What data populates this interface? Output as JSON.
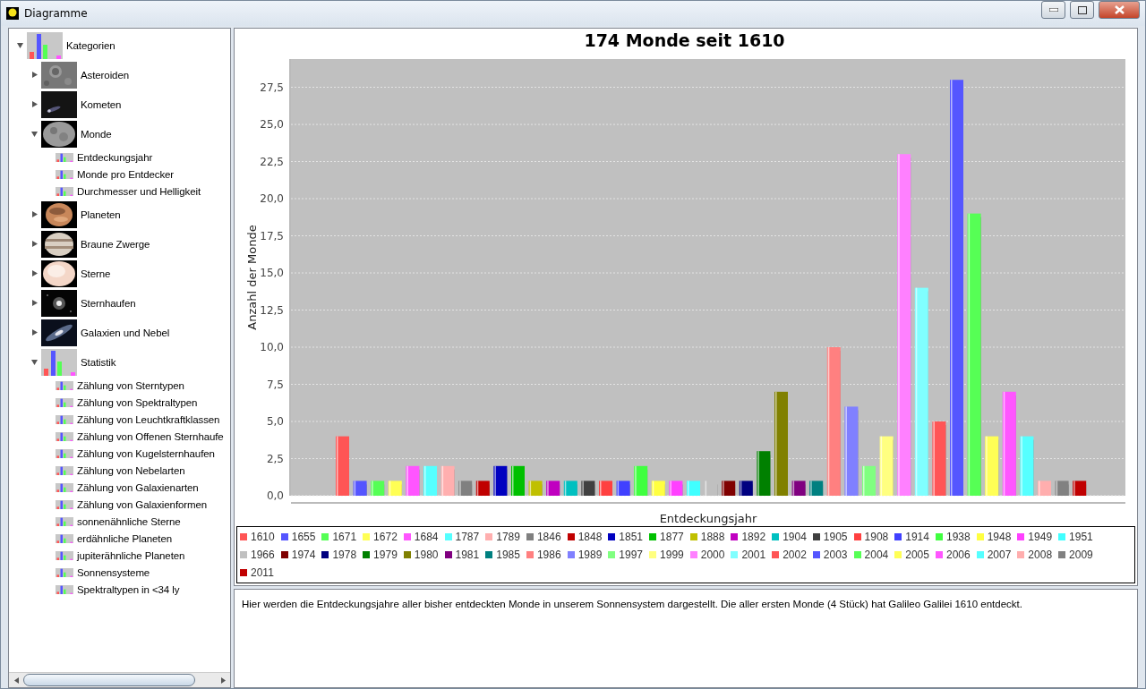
{
  "window": {
    "title": "Diagramme"
  },
  "tree": {
    "label": "Kategorien",
    "kind": "chart",
    "expanded": true,
    "children": [
      {
        "label": "Asteroiden",
        "expanded": false
      },
      {
        "label": "Kometen",
        "expanded": false
      },
      {
        "label": "Monde",
        "expanded": true,
        "children": [
          {
            "label": "Entdeckungsjahr",
            "kind": "item"
          },
          {
            "label": "Monde pro Entdecker",
            "kind": "item"
          },
          {
            "label": "Durchmesser und Helligkeit",
            "kind": "item"
          }
        ]
      },
      {
        "label": "Planeten",
        "expanded": false
      },
      {
        "label": "Braune Zwerge",
        "expanded": false
      },
      {
        "label": "Sterne",
        "expanded": false
      },
      {
        "label": "Sternhaufen",
        "expanded": false
      },
      {
        "label": "Galaxien und Nebel",
        "expanded": false
      },
      {
        "label": "Statistik",
        "kind": "chart",
        "expanded": true,
        "children": [
          {
            "label": "Zählung von Sterntypen",
            "kind": "item"
          },
          {
            "label": "Zählung von Spektraltypen",
            "kind": "item"
          },
          {
            "label": "Zählung von Leuchtkraftklassen",
            "kind": "item"
          },
          {
            "label": "Zählung von Offenen Sternhaufe",
            "kind": "item"
          },
          {
            "label": "Zählung von Kugelsternhaufen",
            "kind": "item"
          },
          {
            "label": "Zählung von Nebelarten",
            "kind": "item"
          },
          {
            "label": "Zählung von Galaxienarten",
            "kind": "item"
          },
          {
            "label": "Zählung von Galaxienformen",
            "kind": "item"
          },
          {
            "label": "sonnenähnliche Sterne",
            "kind": "item"
          },
          {
            "label": "erdähnliche Planeten",
            "kind": "item"
          },
          {
            "label": "jupiterähnliche Planeten",
            "kind": "item"
          },
          {
            "label": "Sonnensysteme",
            "kind": "item"
          },
          {
            "label": "Spektraltypen in <34 ly",
            "kind": "item"
          }
        ]
      }
    ]
  },
  "chart": {
    "chart_data": {
      "type": "bar",
      "title": "174 Monde seit 1610",
      "xlabel": "Entdeckungsjahr",
      "ylabel": "Anzahl der Monde",
      "ylim": [
        0,
        29.4
      ],
      "grid": true,
      "yticks": [
        {
          "value": 0,
          "label": "0,0"
        },
        {
          "value": 2.5,
          "label": "2,5"
        },
        {
          "value": 5,
          "label": "5,0"
        },
        {
          "value": 7.5,
          "label": "7,5"
        },
        {
          "value": 10,
          "label": "10,0"
        },
        {
          "value": 12.5,
          "label": "12,5"
        },
        {
          "value": 15,
          "label": "15,0"
        },
        {
          "value": 17.5,
          "label": "17,5"
        },
        {
          "value": 20,
          "label": "20,0"
        },
        {
          "value": 22.5,
          "label": "22,5"
        },
        {
          "value": 25,
          "label": "25,0"
        },
        {
          "value": 27.5,
          "label": "27,5"
        }
      ],
      "series": [
        {
          "name": "1610",
          "color": "#ff5555",
          "values": [
            4
          ]
        },
        {
          "name": "1655",
          "color": "#5555ff",
          "values": [
            1
          ]
        },
        {
          "name": "1671",
          "color": "#55ff55",
          "values": [
            1
          ]
        },
        {
          "name": "1672",
          "color": "#ffff55",
          "values": [
            1
          ]
        },
        {
          "name": "1684",
          "color": "#ff55ff",
          "values": [
            2
          ]
        },
        {
          "name": "1787",
          "color": "#55ffff",
          "values": [
            2
          ]
        },
        {
          "name": "1789",
          "color": "#ffafaf",
          "values": [
            2
          ]
        },
        {
          "name": "1846",
          "color": "#808080",
          "values": [
            1
          ]
        },
        {
          "name": "1848",
          "color": "#c00000",
          "values": [
            1
          ]
        },
        {
          "name": "1851",
          "color": "#0000c0",
          "values": [
            2
          ]
        },
        {
          "name": "1877",
          "color": "#00c000",
          "values": [
            2
          ]
        },
        {
          "name": "1888",
          "color": "#c0c000",
          "values": [
            1
          ]
        },
        {
          "name": "1892",
          "color": "#c000c0",
          "values": [
            1
          ]
        },
        {
          "name": "1904",
          "color": "#00c0c0",
          "values": [
            1
          ]
        },
        {
          "name": "1905",
          "color": "#404040",
          "values": [
            1
          ]
        },
        {
          "name": "1908",
          "color": "#ff4040",
          "values": [
            1
          ]
        },
        {
          "name": "1914",
          "color": "#4040ff",
          "values": [
            1
          ]
        },
        {
          "name": "1938",
          "color": "#40ff40",
          "values": [
            2
          ]
        },
        {
          "name": "1948",
          "color": "#ffff40",
          "values": [
            1
          ]
        },
        {
          "name": "1949",
          "color": "#ff40ff",
          "values": [
            1
          ]
        },
        {
          "name": "1951",
          "color": "#40ffff",
          "values": [
            1
          ]
        },
        {
          "name": "1966",
          "color": "#c0c0c0",
          "values": [
            1
          ]
        },
        {
          "name": "1974",
          "color": "#800000",
          "values": [
            1
          ]
        },
        {
          "name": "1978",
          "color": "#000080",
          "values": [
            1
          ]
        },
        {
          "name": "1979",
          "color": "#008000",
          "values": [
            3
          ]
        },
        {
          "name": "1980",
          "color": "#808000",
          "values": [
            7
          ]
        },
        {
          "name": "1981",
          "color": "#800080",
          "values": [
            1
          ]
        },
        {
          "name": "1985",
          "color": "#008080",
          "values": [
            1
          ]
        },
        {
          "name": "1986",
          "color": "#ff8080",
          "values": [
            10
          ]
        },
        {
          "name": "1989",
          "color": "#8080ff",
          "values": [
            6
          ]
        },
        {
          "name": "1997",
          "color": "#80ff80",
          "values": [
            2
          ]
        },
        {
          "name": "1999",
          "color": "#ffff80",
          "values": [
            4
          ]
        },
        {
          "name": "2000",
          "color": "#ff80ff",
          "values": [
            23
          ]
        },
        {
          "name": "2001",
          "color": "#80ffff",
          "values": [
            14
          ]
        },
        {
          "name": "2002",
          "color": "#ff5556",
          "values": [
            5
          ]
        },
        {
          "name": "2003",
          "color": "#5556ff",
          "values": [
            28
          ]
        },
        {
          "name": "2004",
          "color": "#56ff55",
          "values": [
            19
          ]
        },
        {
          "name": "2005",
          "color": "#ffff56",
          "values": [
            4
          ]
        },
        {
          "name": "2006",
          "color": "#ff56ff",
          "values": [
            7
          ]
        },
        {
          "name": "2007",
          "color": "#56ffff",
          "values": [
            4
          ]
        },
        {
          "name": "2008",
          "color": "#ffaeae",
          "values": [
            1
          ]
        },
        {
          "name": "2009",
          "color": "#818181",
          "values": [
            1
          ]
        },
        {
          "name": "2011",
          "color": "#c00001",
          "values": [
            1
          ]
        }
      ]
    }
  },
  "description": "Hier werden die Entdeckungsjahre aller bisher entdeckten Monde in unserem Sonnensystem dargestellt. Die aller ersten Monde (4 Stück) hat Galileo Galilei 1610 entdeckt."
}
